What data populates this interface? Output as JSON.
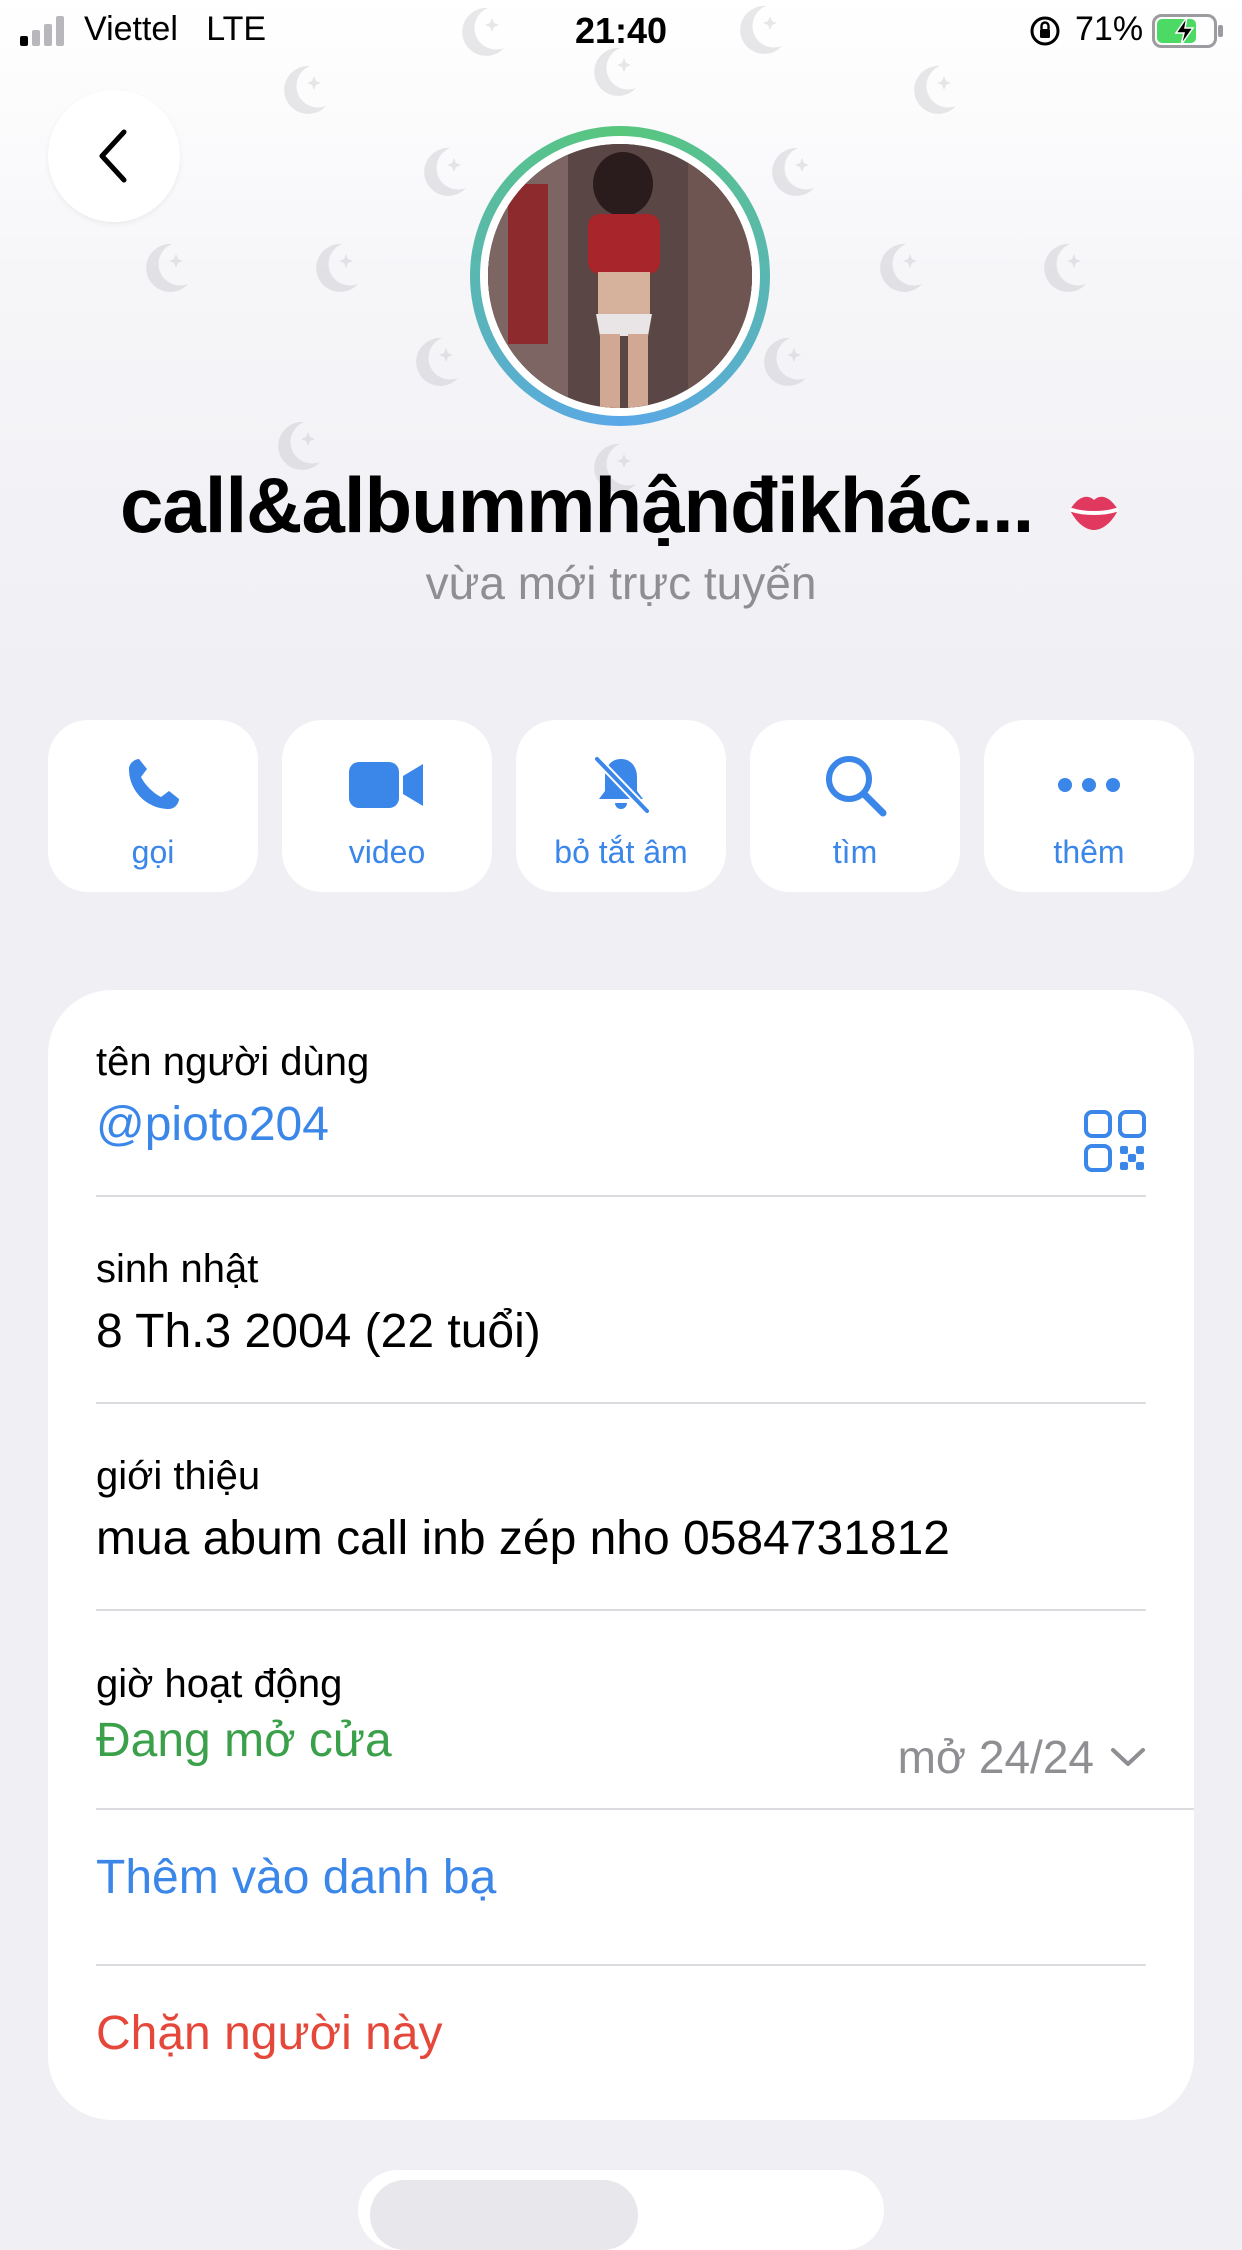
{
  "status_bar": {
    "carrier": "Viettel",
    "network": "LTE",
    "time": "21:40",
    "battery_percent": "71%",
    "battery_level": 0.71,
    "icons": [
      "signal-icon",
      "orientation-lock-icon",
      "battery-charging-icon"
    ]
  },
  "header": {
    "back_icon": "chevron-left-icon",
    "display_name": "call&albummhậnđikhác...",
    "name_emoji_icon": "lips-icon",
    "presence": "vừa mới trực tuyến",
    "pattern_icon": "moon-star-icon",
    "accent_colors": {
      "ring_start": "#58c77c",
      "ring_end": "#5aa7e8"
    }
  },
  "actions": [
    {
      "label": "gọi",
      "icon": "phone-icon"
    },
    {
      "label": "video",
      "icon": "video-camera-icon"
    },
    {
      "label": "bỏ tắt âm",
      "icon": "bell-muted-icon"
    },
    {
      "label": "tìm",
      "icon": "search-icon"
    },
    {
      "label": "thêm",
      "icon": "more-icon"
    }
  ],
  "info": {
    "username": {
      "label": "tên người dùng",
      "value": "@pioto204",
      "icon": "qr-code-icon"
    },
    "birthday": {
      "label": "sinh nhật",
      "value": "8 Th.3 2004 (22 tuổi)"
    },
    "bio": {
      "label": "giới thiệu",
      "value": "mua abum call inb zép nho 0584731812"
    },
    "hours": {
      "label": "giờ hoạt động",
      "status": "Đang mở cửa",
      "schedule": "mở 24/24",
      "icon": "chevron-down-icon"
    },
    "add_contact": "Thêm vào danh bạ",
    "block": "Chặn người này"
  },
  "colors": {
    "accent": "#3a86e9",
    "open_green": "#3aa04a",
    "danger_red": "#e5483a",
    "secondary_gray": "#8e8e93"
  }
}
